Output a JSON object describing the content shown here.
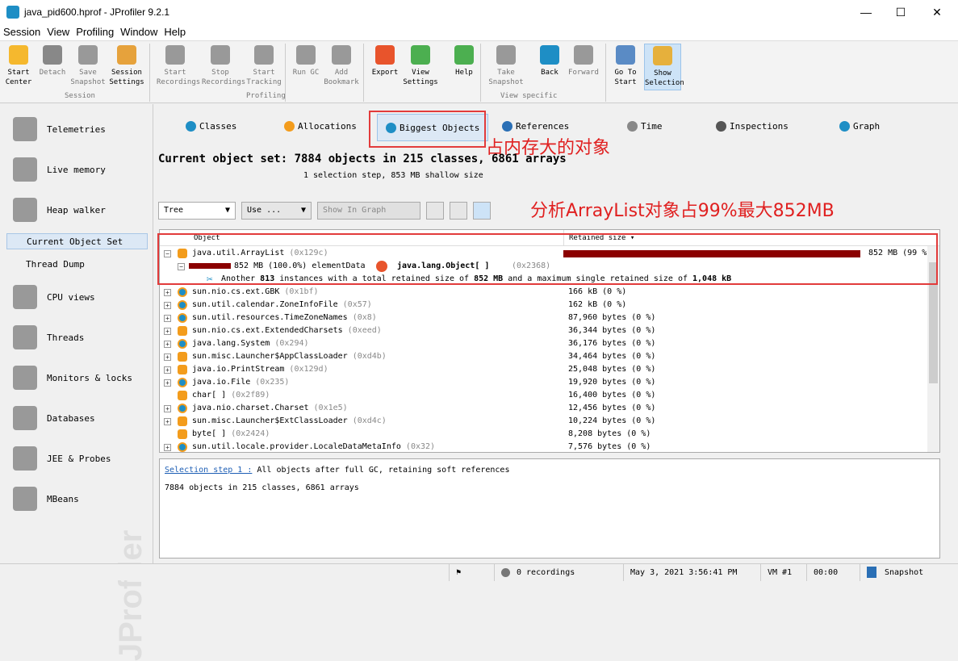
{
  "window": {
    "title": "java_pid600.hprof - JProfiler 9.2.1",
    "minimize": "—",
    "maximize": "☐",
    "close": "✕"
  },
  "menu": [
    "Session",
    "View",
    "Profiling",
    "Window",
    "Help"
  ],
  "toolbar": {
    "buttons": [
      {
        "l1": "Start",
        "l2": "Center",
        "icon": "start-center-icon",
        "color": "#f5b82e",
        "enabled": true
      },
      {
        "l1": "Detach",
        "l2": "",
        "icon": "detach-icon",
        "color": "#888",
        "enabled": false
      },
      {
        "l1": "Save",
        "l2": "Snapshot",
        "icon": "save-icon",
        "color": "#999",
        "enabled": false
      },
      {
        "l1": "Session",
        "l2": "Settings",
        "icon": "settings-icon",
        "color": "#e6a23c",
        "enabled": true
      },
      {
        "l1": "Start",
        "l2": "Recordings",
        "icon": "record-icon",
        "color": "#999",
        "enabled": false
      },
      {
        "l1": "Stop",
        "l2": "Recordings",
        "icon": "stop-icon",
        "color": "#999",
        "enabled": false
      },
      {
        "l1": "Start",
        "l2": "Tracking",
        "icon": "tracking-icon",
        "color": "#999",
        "enabled": false
      },
      {
        "l1": "Run GC",
        "l2": "",
        "icon": "gc-icon",
        "color": "#999",
        "enabled": false
      },
      {
        "l1": "Add",
        "l2": "Bookmark",
        "icon": "bookmark-icon",
        "color": "#999",
        "enabled": false
      },
      {
        "l1": "Export",
        "l2": "",
        "icon": "export-icon",
        "color": "#e8542c",
        "enabled": true
      },
      {
        "l1": "View",
        "l2": "Settings",
        "icon": "view-settings-icon",
        "color": "#4caf50",
        "enabled": true
      },
      {
        "l1": "Help",
        "l2": "",
        "icon": "help-icon",
        "color": "#4caf50",
        "enabled": true
      },
      {
        "l1": "Take",
        "l2": "Snapshot",
        "icon": "camera-icon",
        "color": "#999",
        "enabled": false
      },
      {
        "l1": "Back",
        "l2": "",
        "icon": "back-icon",
        "color": "#1e8ec5",
        "enabled": true
      },
      {
        "l1": "Forward",
        "l2": "",
        "icon": "forward-icon",
        "color": "#999",
        "enabled": false
      },
      {
        "l1": "Go To",
        "l2": "Start",
        "icon": "home-icon",
        "color": "#5a8bc5",
        "enabled": true
      },
      {
        "l1": "Show",
        "l2": "Selection",
        "icon": "show-selection-icon",
        "color": "#e6b03c",
        "enabled": true,
        "selected": true
      }
    ],
    "groups": [
      "Session",
      "Profiling",
      "View specific"
    ]
  },
  "sidebar": {
    "items": [
      {
        "label": "Telemetries",
        "icon": "telemetries-icon"
      },
      {
        "label": "Live memory",
        "icon": "live-memory-icon"
      },
      {
        "label": "Heap walker",
        "icon": "heap-walker-icon"
      },
      {
        "label": "CPU views",
        "icon": "cpu-icon"
      },
      {
        "label": "Threads",
        "icon": "threads-icon"
      },
      {
        "label": "Monitors & locks",
        "icon": "lock-icon"
      },
      {
        "label": "Databases",
        "icon": "database-icon"
      },
      {
        "label": "JEE & Probes",
        "icon": "probe-icon"
      },
      {
        "label": "MBeans",
        "icon": "mbeans-icon"
      }
    ],
    "subitems": [
      "Current Object Set",
      "Thread Dump"
    ],
    "watermark": "JProfiler"
  },
  "tabs": [
    {
      "label": "Classes",
      "color": "#1e8ec5"
    },
    {
      "label": "Allocations",
      "color": "#f39c1c"
    },
    {
      "label": "Biggest Objects",
      "color": "#1e8ec5",
      "selected": true
    },
    {
      "label": "References",
      "color": "#2a6fb5"
    },
    {
      "label": "Time",
      "color": "#888"
    },
    {
      "label": "Inspections",
      "color": "#555"
    },
    {
      "label": "Graph",
      "color": "#1e8ec5"
    }
  ],
  "annotations": {
    "tab": "占内存大的对象",
    "tree": "分析ArrayList对象占99%最大852MB"
  },
  "object_set": {
    "title": "Current object set: 7884 objects in 215 classes, 6861 arrays",
    "step": "1 selection step, 853 MB shallow size"
  },
  "controls": {
    "view_mode": "Tree",
    "use": "Use ...",
    "show_graph": "Show In Graph"
  },
  "table": {
    "columns": [
      "Object",
      "Retained size ▾"
    ],
    "top": {
      "name": "java.util.ArrayList",
      "hex": "(0x129c)",
      "size": "852 MB (99 %)",
      "fraction": 0.99
    },
    "child": {
      "size": "852 MB (100.0%) elementData",
      "target": "java.lang.Object[ ]",
      "hex": "(0x2368)"
    },
    "another": {
      "p1": "Another ",
      "count": "813",
      "p2": " instances with a total retained size of ",
      "total": "852 MB",
      "p3": " and a maximum single retained size of ",
      "max": "1,048 kB"
    },
    "rows": [
      {
        "name": "sun.nio.cs.ext.GBK",
        "hex": "(0x1bf)",
        "size": "166 kB (0 %)",
        "kind": "class",
        "exp": true
      },
      {
        "name": "sun.util.calendar.ZoneInfoFile",
        "hex": "(0x57)",
        "size": "162 kB (0 %)",
        "kind": "class",
        "exp": true
      },
      {
        "name": "sun.util.resources.TimeZoneNames",
        "hex": "(0x8)",
        "size": "87,960 bytes (0 %)",
        "kind": "class",
        "exp": true
      },
      {
        "name": "sun.nio.cs.ext.ExtendedCharsets",
        "hex": "(0xeed)",
        "size": "36,344 bytes (0 %)",
        "kind": "obj",
        "exp": true
      },
      {
        "name": "java.lang.System",
        "hex": "(0x294)",
        "size": "36,176 bytes (0 %)",
        "kind": "class",
        "exp": true
      },
      {
        "name": "sun.misc.Launcher$AppClassLoader",
        "hex": "(0xd4b)",
        "size": "34,464 bytes (0 %)",
        "kind": "obj",
        "exp": true
      },
      {
        "name": "java.io.PrintStream",
        "hex": "(0x129d)",
        "size": "25,048 bytes (0 %)",
        "kind": "obj",
        "exp": true
      },
      {
        "name": "java.io.File",
        "hex": "(0x235)",
        "size": "19,920 bytes (0 %)",
        "kind": "class",
        "exp": true
      },
      {
        "name": "char[ ]",
        "hex": "(0x2f89)",
        "size": "16,400 bytes (0 %)",
        "kind": "obj",
        "exp": false
      },
      {
        "name": "java.nio.charset.Charset",
        "hex": "(0x1e5)",
        "size": "12,456 bytes (0 %)",
        "kind": "class",
        "exp": true
      },
      {
        "name": "sun.misc.Launcher$ExtClassLoader",
        "hex": "(0xd4c)",
        "size": "10,224 bytes (0 %)",
        "kind": "obj",
        "exp": true
      },
      {
        "name": "byte[ ]",
        "hex": "(0x2424)",
        "size": "8,208 bytes (0 %)",
        "kind": "obj",
        "exp": false
      },
      {
        "name": "sun.util.locale.provider.LocaleDataMetaInfo",
        "hex": "(0x32)",
        "size": "7,576 bytes (0 %)",
        "kind": "class",
        "exp": true
      }
    ]
  },
  "detail": {
    "link": "Selection step 1 :",
    "desc": " All objects after full GC, retaining soft references",
    "summary": "7884 objects in 215 classes, 6861 arrays"
  },
  "status": {
    "recordings": "0 recordings",
    "datetime": "May 3, 2021 3:56:41 PM",
    "vm": "VM #1",
    "time": "00:00",
    "mode": "Snapshot"
  },
  "colors": {
    "bar": "#8b0000",
    "annotation": "#e02020",
    "selection": "#dce8f5"
  }
}
